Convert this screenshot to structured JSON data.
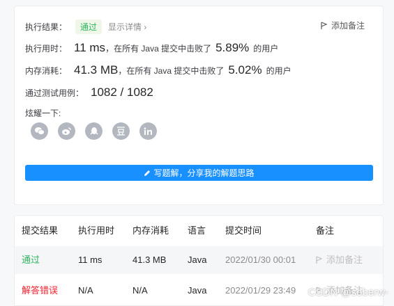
{
  "result": {
    "label": "执行结果：",
    "status": "通过",
    "detail_link": "显示详情 ›",
    "add_note": "添加备注"
  },
  "runtime": {
    "label": "执行用时：",
    "value": "11 ms",
    "prefix": "，在所有 Java 提交中击败了",
    "percent": "5.89%",
    "suffix": "的用户"
  },
  "memory": {
    "label": "内存消耗：",
    "value": "41.3 MB",
    "prefix": "，在所有 Java 提交中击败了",
    "percent": "5.02%",
    "suffix": "的用户"
  },
  "tests": {
    "label": "通过测试用例：",
    "value": "1082 / 1082"
  },
  "share": {
    "label": "炫耀一下:",
    "icons": [
      "wechat-icon",
      "weibo-icon",
      "qq-icon",
      "douban-icon",
      "linkedin-icon"
    ]
  },
  "write_solution": "写题解，分享我的解题思路",
  "table": {
    "headers": [
      "提交结果",
      "执行用时",
      "内存消耗",
      "语言",
      "提交时间",
      "备注"
    ],
    "rows": [
      {
        "result": "通过",
        "runtime": "11 ms",
        "memory": "41.3 MB",
        "lang": "Java",
        "time": "2022/01/30 00:01",
        "note": "添加备注"
      },
      {
        "result": "解答错误",
        "runtime": "N/A",
        "memory": "N/A",
        "lang": "Java",
        "time": "2022/01/29 23:49",
        "note": "添加备注"
      }
    ]
  },
  "watermark": "CSDN @soberw-",
  "colors": {
    "accent": "#1890ff",
    "success": "#2db55d",
    "error": "#f5222d"
  }
}
